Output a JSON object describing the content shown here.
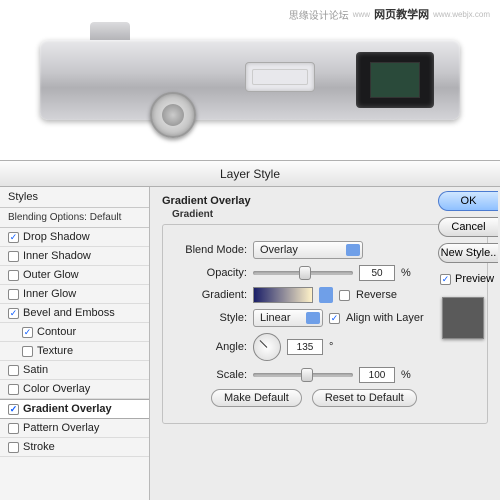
{
  "watermark": {
    "text1": "思缘设计论坛",
    "text2": "网页教学网",
    "url": "www.webjx.com"
  },
  "dialog": {
    "title": "Layer Style",
    "sidebar": {
      "header": "Styles",
      "subheader": "Blending Options: Default",
      "items": [
        {
          "label": "Drop Shadow",
          "checked": true,
          "indent": false
        },
        {
          "label": "Inner Shadow",
          "checked": false,
          "indent": false
        },
        {
          "label": "Outer Glow",
          "checked": false,
          "indent": false
        },
        {
          "label": "Inner Glow",
          "checked": false,
          "indent": false
        },
        {
          "label": "Bevel and Emboss",
          "checked": true,
          "indent": false
        },
        {
          "label": "Contour",
          "checked": true,
          "indent": true
        },
        {
          "label": "Texture",
          "checked": false,
          "indent": true
        },
        {
          "label": "Satin",
          "checked": false,
          "indent": false
        },
        {
          "label": "Color Overlay",
          "checked": false,
          "indent": false
        },
        {
          "label": "Gradient Overlay",
          "checked": true,
          "indent": false,
          "selected": true
        },
        {
          "label": "Pattern Overlay",
          "checked": false,
          "indent": false
        },
        {
          "label": "Stroke",
          "checked": false,
          "indent": false
        }
      ]
    },
    "panel": {
      "title": "Gradient Overlay",
      "subtitle": "Gradient",
      "labels": {
        "blend_mode": "Blend Mode:",
        "opacity": "Opacity:",
        "gradient": "Gradient:",
        "reverse": "Reverse",
        "style": "Style:",
        "align": "Align with Layer",
        "angle": "Angle:",
        "scale": "Scale:"
      },
      "values": {
        "blend_mode": "Overlay",
        "opacity": "50",
        "opacity_pct": "%",
        "reverse": false,
        "style": "Linear",
        "align": true,
        "angle": "135",
        "angle_deg": "°",
        "scale": "100",
        "scale_pct": "%"
      },
      "buttons": {
        "make_default": "Make Default",
        "reset": "Reset to Default"
      }
    },
    "right": {
      "ok": "OK",
      "cancel": "Cancel",
      "new_style": "New Style..",
      "preview_label": "Preview",
      "preview_checked": true
    }
  }
}
